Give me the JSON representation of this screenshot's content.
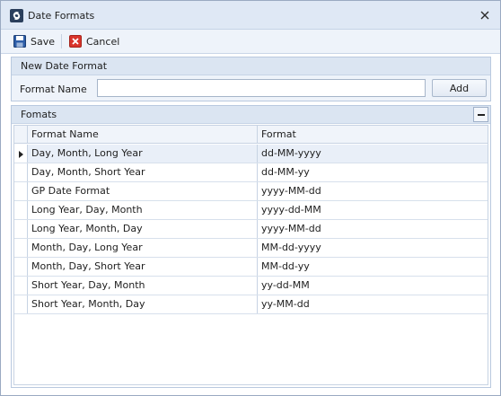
{
  "window": {
    "title": "Date Formats",
    "app_icon": "app-logo-icon",
    "close_icon": "close-icon"
  },
  "toolbar": {
    "save_label": "Save",
    "save_icon": "floppy-disk-icon",
    "cancel_label": "Cancel",
    "cancel_icon": "red-x-icon"
  },
  "new_format": {
    "header": "New Date Format",
    "name_label": "Format Name",
    "name_value": "",
    "add_label": "Add"
  },
  "formats": {
    "header": "Fomats",
    "columns": {
      "name": "Format Name",
      "format": "Format"
    },
    "rows": [
      {
        "name": "Day, Month, Long Year",
        "format": "dd-MM-yyyy"
      },
      {
        "name": "Day, Month, Short Year",
        "format": "dd-MM-yy"
      },
      {
        "name": "GP Date Format",
        "format": "yyyy-MM-dd"
      },
      {
        "name": "Long Year, Day, Month",
        "format": "yyyy-dd-MM"
      },
      {
        "name": "Long Year, Month, Day",
        "format": "yyyy-MM-dd"
      },
      {
        "name": "Month, Day, Long Year",
        "format": "MM-dd-yyyy"
      },
      {
        "name": "Month, Day, Short Year",
        "format": "MM-dd-yy"
      },
      {
        "name": "Short Year, Day, Month",
        "format": "yy-dd-MM"
      },
      {
        "name": "Short Year, Month, Day",
        "format": "yy-MM-dd"
      }
    ]
  },
  "colors": {
    "accent": "#dfe8f5",
    "selection": "#e9eff8",
    "cancel_red": "#d9342b",
    "save_blue": "#2e5ea8"
  }
}
